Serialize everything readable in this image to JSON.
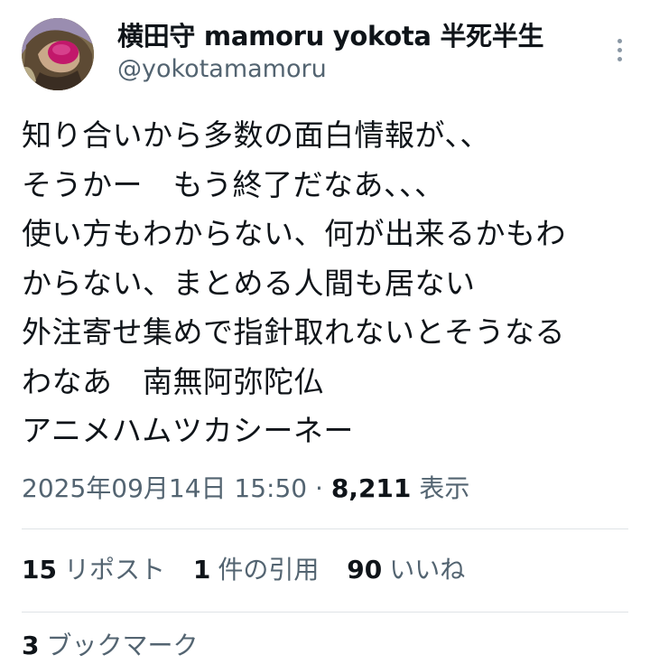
{
  "author": {
    "display_name": "横田守 mamoru yokota 半死半生",
    "handle": "@yokotamamoru"
  },
  "tweet": {
    "lines": [
      "知り合いから多数の面白情報が、、",
      "そうかー　もう終了だなあ、、、",
      "使い方もわからない、何が出来るかもわ",
      "からない、まとめる人間も居ない",
      "外注寄せ集めで指針取れないとそうなる",
      "わなあ　南無阿弥陀仏",
      "アニメハムツカシーネー"
    ]
  },
  "meta": {
    "timestamp": "2025年09月14日 15:50",
    "separator": "·",
    "views_count": "8,211",
    "views_label": "表示"
  },
  "stats": {
    "reposts_count": "15",
    "reposts_label": "リポスト",
    "quotes_count": "1",
    "quotes_label": "件の引用",
    "likes_count": "90",
    "likes_label": "いいね"
  },
  "next_row": {
    "count": "3",
    "label": "ブックマーク"
  },
  "colors": {
    "text": "#0f1419",
    "secondary": "#536471",
    "divider": "#dfe3e6",
    "background": "#ffffff"
  }
}
